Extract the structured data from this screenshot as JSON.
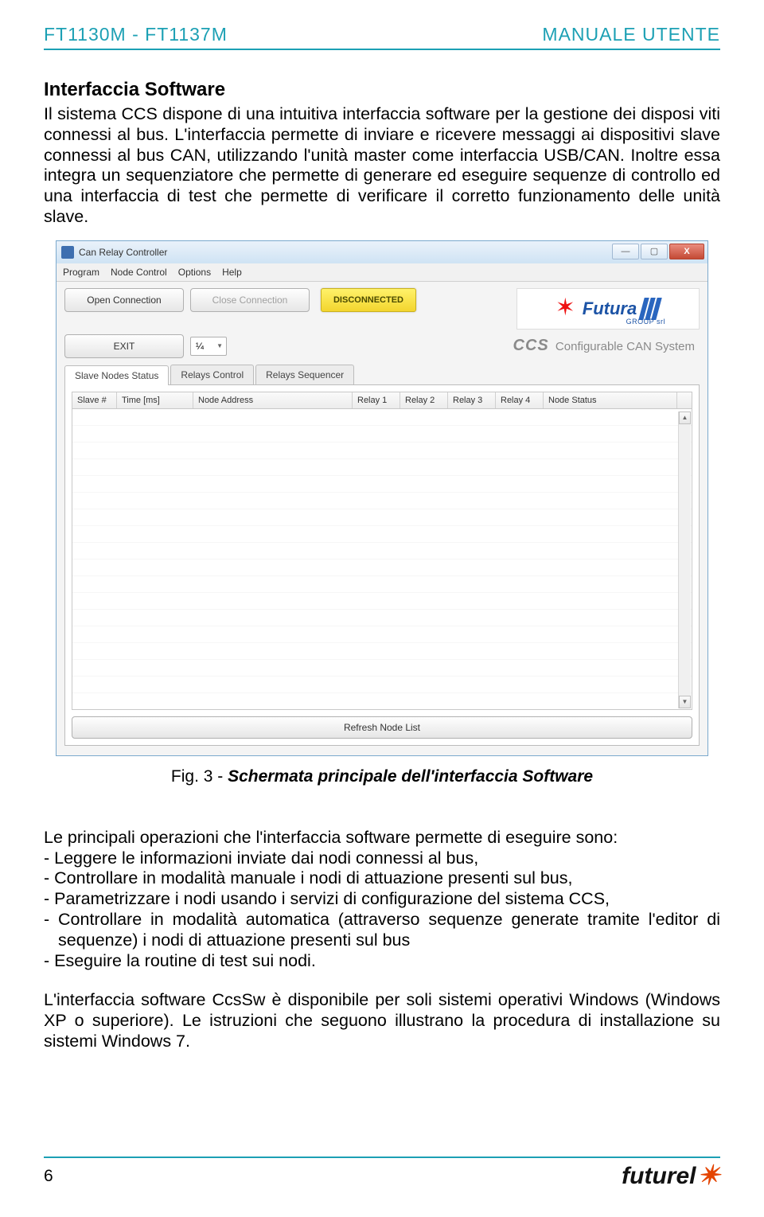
{
  "header": {
    "left": "FT1130M - FT1137M",
    "right": "MANUALE UTENTE"
  },
  "section_title": "Interfaccia Software",
  "paragraph1": "Il sistema CCS dispone di una intuitiva interfaccia software per la gestione dei disposi viti connessi al bus. L'interfaccia permette di inviare e ricevere messaggi ai dispositivi slave connessi al bus CAN, utilizzando l'unità master come interfaccia USB/CAN. Inoltre essa integra un sequenziatore che permette di generare ed eseguire sequenze di controllo ed una interfaccia di test che permette di verificare il corretto funzionamento delle unità slave.",
  "screenshot": {
    "window_title": "Can Relay Controller",
    "menu": [
      "Program",
      "Node Control",
      "Options",
      "Help"
    ],
    "buttons": {
      "open": "Open Connection",
      "close": "Close Connection",
      "exit": "EXIT",
      "refresh": "Refresh Node List"
    },
    "status": "DISCONNECTED",
    "spinner_value": "¼",
    "logo_text": "Futura",
    "logo_sub": "GROUP srl",
    "ccs_big": "CCS",
    "ccs_small": "Configurable CAN System",
    "tabs": [
      "Slave Nodes Status",
      "Relays Control",
      "Relays Sequencer"
    ],
    "grid_headers": {
      "slave": "Slave #",
      "time": "Time [ms]",
      "addr": "Node Address",
      "r1": "Relay 1",
      "r2": "Relay 2",
      "r3": "Relay 3",
      "r4": "Relay 4",
      "nstat": "Node Status"
    }
  },
  "fig_caption_prefix": "Fig. 3 - ",
  "fig_caption_italic": "Schermata principale dell'interfaccia Software",
  "ops_intro": "Le principali operazioni che l'interfaccia software permette di eseguire sono:",
  "ops": [
    "- Leggere le informazioni inviate dai nodi connessi al bus,",
    "- Controllare in modalità manuale i nodi di attuazione presenti sul bus,",
    "- Parametrizzare i nodi usando i servizi di configurazione del sistema CCS,",
    "- Controllare in modalità automatica (attraverso sequenze generate tramite l'editor di sequenze) i nodi di attuazione presenti sul bus",
    "- Eseguire la routine di test sui nodi."
  ],
  "paragraph2": "L'interfaccia software CcsSw è disponibile per soli sistemi operativi Windows (Windows XP o superiore). Le istruzioni che seguono illustrano la procedura di installazione su sistemi Windows 7.",
  "page_number": "6",
  "footer_logo": "futurel"
}
